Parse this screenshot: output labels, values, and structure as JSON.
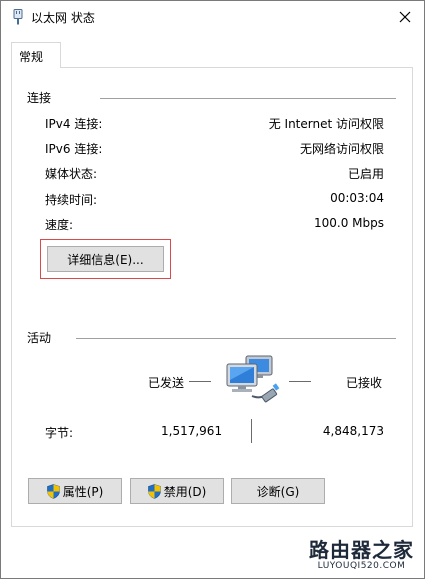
{
  "window": {
    "title": "以太网 状态",
    "close_glyph": "✕",
    "icon": "ethernet-adapter-icon"
  },
  "tabs": [
    {
      "label": "常规"
    }
  ],
  "connection": {
    "label": "连接",
    "rows": [
      {
        "label": "IPv4 连接:",
        "value": "无 Internet 访问权限"
      },
      {
        "label": "IPv6 连接:",
        "value": "无网络访问权限"
      },
      {
        "label": "媒体状态:",
        "value": "已启用"
      },
      {
        "label": "持续时间:",
        "value": "00:03:04"
      },
      {
        "label": "速度:",
        "value": "100.0 Mbps"
      }
    ],
    "details_button": "详细信息(E)..."
  },
  "activity": {
    "label": "活动",
    "sent_label": "已发送",
    "received_label": "已接收",
    "bytes_label": "字节:",
    "bytes_sent": "1,517,961",
    "bytes_received": "4,848,173",
    "icon": "network-computers-icon"
  },
  "buttons": {
    "properties": "属性(P)",
    "disable": "禁用(D)",
    "diagnose": "诊断(G)"
  },
  "watermark": {
    "cn": "路由器之家",
    "en": "LUYOUQI520.COM"
  },
  "colors": {
    "highlight": "#d94a4a",
    "button_bg": "#e1e1e1",
    "button_border": "#adadad",
    "shield_blue": "#1f6fc4",
    "shield_yellow": "#f2c200"
  }
}
